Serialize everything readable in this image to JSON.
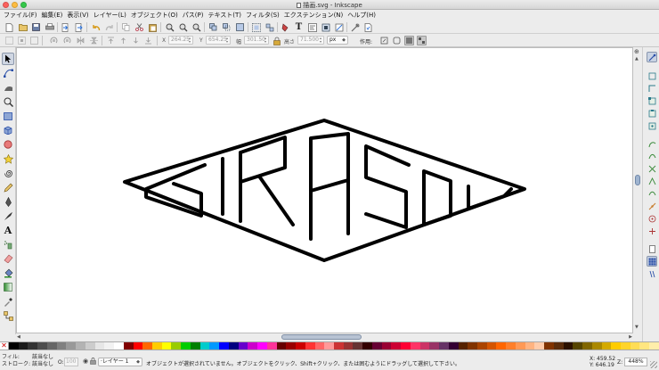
{
  "window": {
    "title": "描画.svg - Inkscape"
  },
  "menu": [
    "ファイル(F)",
    "編集(E)",
    "表示(V)",
    "レイヤー(L)",
    "オブジェクト(O)",
    "パス(P)",
    "テキスト(T)",
    "フィルタ(S)",
    "エクステンション(N)",
    "ヘルプ(H)"
  ],
  "controls": {
    "x_label": "X",
    "x_value": "264.25",
    "y_label": "Y",
    "y_value": "654.25",
    "w_label": "幅",
    "w_value": "301.50",
    "h_label": "高さ",
    "h_value": "71.500",
    "unit": "px",
    "affect_label": "作用:"
  },
  "status": {
    "fill_label": "フィル:",
    "fill_value": "該当なし",
    "stroke_label": "ストローク:",
    "stroke_value": "該当なし",
    "opacity_label": "O:",
    "opacity_value": "100",
    "layer": "·レイヤー 1",
    "message": "オブジェクトが選択されていません。オブジェクトをクリック、Shift+クリック、または囲むようにドラッグして選択して下さい。",
    "cursor_x": "X: 459.52",
    "cursor_y": "Y: 646.19",
    "zoom_label": "Z:",
    "zoom_value": "448%"
  },
  "palette_colors": [
    "#000000",
    "#1a1a1a",
    "#333333",
    "#4d4d4d",
    "#666666",
    "#808080",
    "#999999",
    "#b3b3b3",
    "#cccccc",
    "#e6e6e6",
    "#f2f2f2",
    "#ffffff",
    "#800000",
    "#ff0000",
    "#ff6600",
    "#ffcc00",
    "#ffff00",
    "#99cc00",
    "#00cc00",
    "#008000",
    "#00cccc",
    "#0099ff",
    "#0000ff",
    "#000080",
    "#6600cc",
    "#cc00cc",
    "#ff00ff",
    "#ff3399",
    "#660000",
    "#990000",
    "#cc0000",
    "#ff3333",
    "#ff6666",
    "#ff9999",
    "#cc3333",
    "#993333",
    "#663333",
    "#330000",
    "#660033",
    "#990033",
    "#cc0033",
    "#ff0033",
    "#ff3366",
    "#cc3366",
    "#993366",
    "#663366",
    "#330033",
    "#552200",
    "#803300",
    "#aa4400",
    "#d45500",
    "#ff6600",
    "#ff7f2a",
    "#ff9955",
    "#ffb380",
    "#ffccaa",
    "#803300",
    "#5a2d0c",
    "#2b1100",
    "#554400",
    "#806600",
    "#aa8800",
    "#d4aa00",
    "#ffcc00",
    "#ffd42a",
    "#ffdd55",
    "#ffe680",
    "#ffeeaa"
  ],
  "drawing": {
    "stroke": "#000000",
    "fill": "#ffffff"
  }
}
